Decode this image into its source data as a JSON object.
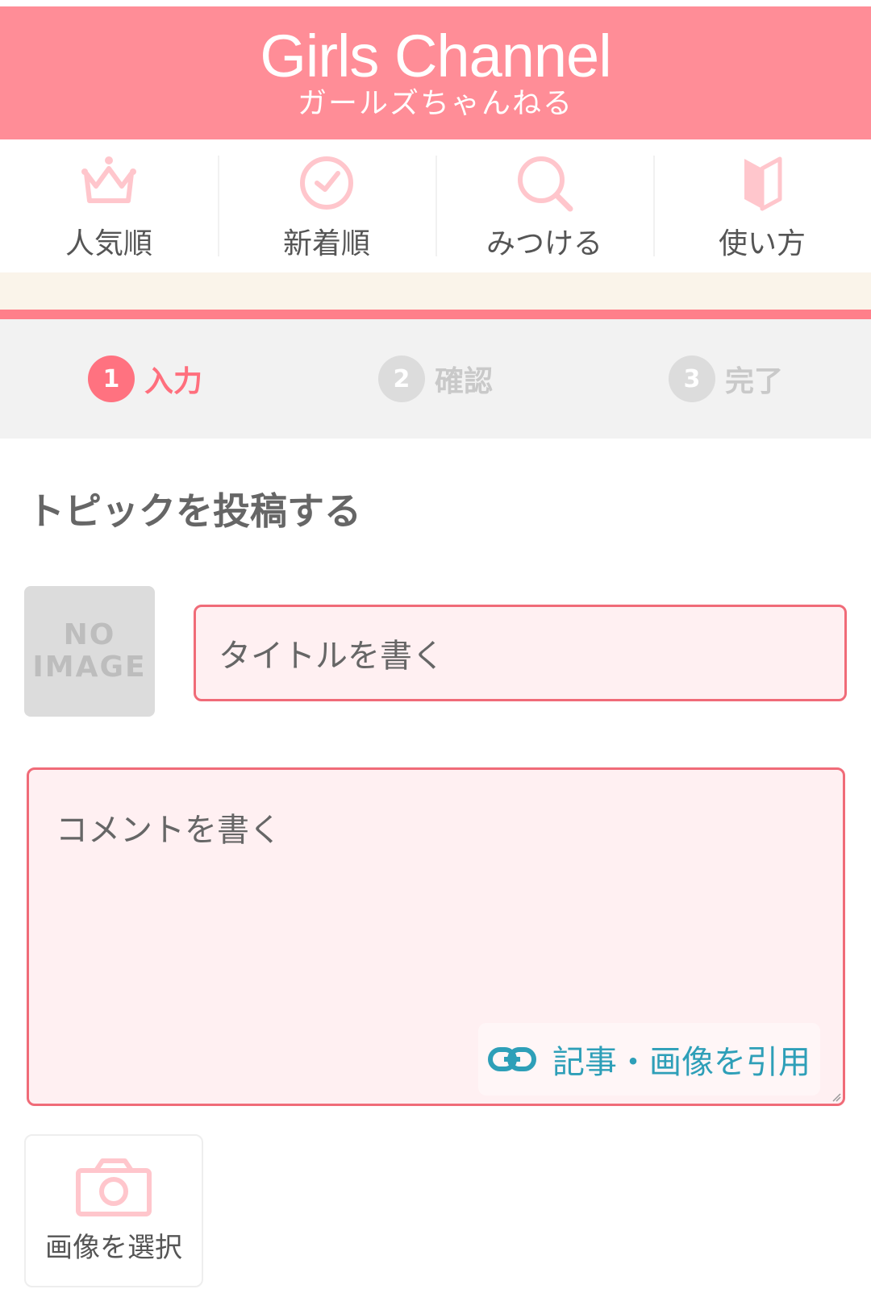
{
  "header": {
    "logo_en": "Girls Channel",
    "logo_ja": "ガールズちゃんねる",
    "bg_color": "#ff8d97"
  },
  "nav": {
    "items": [
      {
        "label": "人気順",
        "icon": "crown-icon"
      },
      {
        "label": "新着順",
        "icon": "clock-icon"
      },
      {
        "label": "みつける",
        "icon": "search-icon"
      },
      {
        "label": "使い方",
        "icon": "beginner-mark-icon"
      }
    ]
  },
  "steps": [
    {
      "num": "1",
      "label": "入力",
      "active": true
    },
    {
      "num": "2",
      "label": "確認",
      "active": false
    },
    {
      "num": "3",
      "label": "完了",
      "active": false
    }
  ],
  "page_title": "トピックを投稿する",
  "form": {
    "no_image_line1": "NO",
    "no_image_line2": "IMAGE",
    "title_placeholder": "タイトルを書く",
    "comment_placeholder": "コメントを書く",
    "quote_label": "記事・画像を引用",
    "image_select_label": "画像を選択"
  },
  "colors": {
    "accent": "#ff7280",
    "input_border": "#f06b78",
    "input_bg": "#fff0f2",
    "link": "#2e9fb8"
  }
}
